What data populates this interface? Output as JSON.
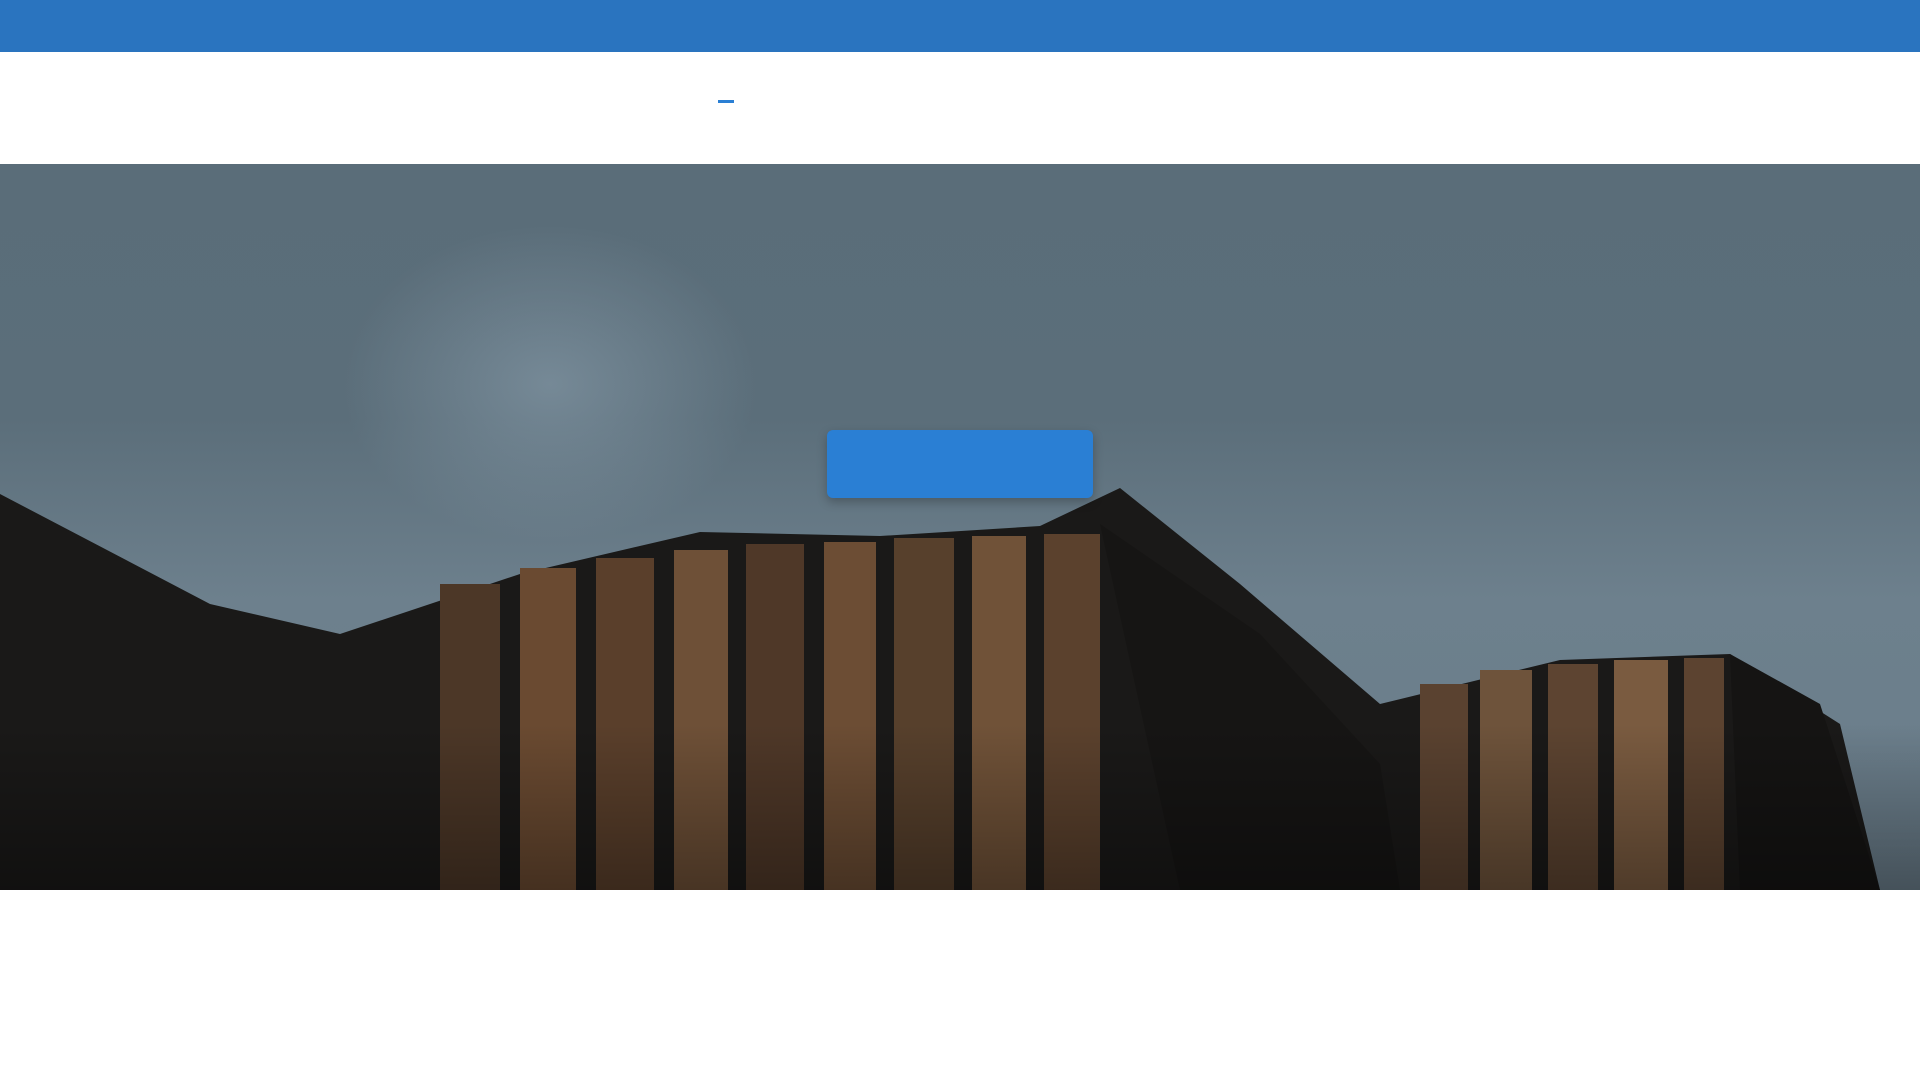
{
  "topbar": {
    "text": ""
  },
  "header": {
    "logo_text": "",
    "nav": [
      {
        "label": "",
        "active": true
      },
      {
        "label": "",
        "active": false
      },
      {
        "label": "",
        "active": false
      },
      {
        "label": "",
        "active": false
      }
    ],
    "action_label": ""
  },
  "hero": {
    "title": "",
    "cta_label": ""
  },
  "section": {
    "title": ""
  },
  "colors": {
    "brand_blue": "#2a74bf",
    "accent_blue": "#2a7fd4"
  }
}
